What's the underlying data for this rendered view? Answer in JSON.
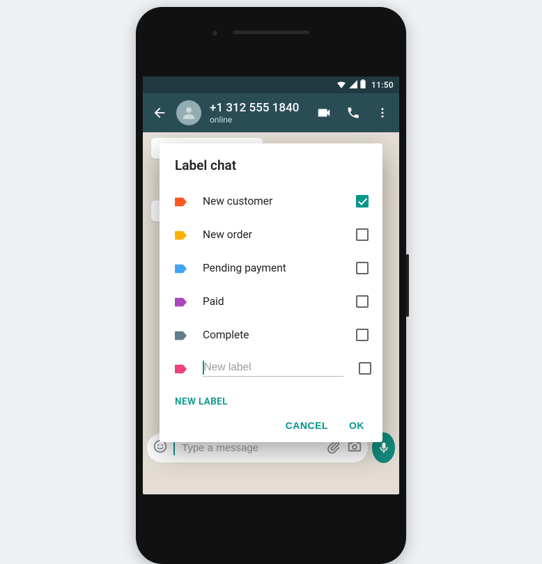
{
  "statusbar": {
    "time": "11:50"
  },
  "header": {
    "contact_name": "+1 312 555 1840",
    "status": "online"
  },
  "composer": {
    "placeholder": "Type a message"
  },
  "dialog": {
    "title": "Label chat",
    "labels": [
      {
        "name": "New customer",
        "color": "#ff5722",
        "checked": true
      },
      {
        "name": "New order",
        "color": "#ffb300",
        "checked": false
      },
      {
        "name": "Pending payment",
        "color": "#42a5f5",
        "checked": false
      },
      {
        "name": "Paid",
        "color": "#ab47bc",
        "checked": false
      },
      {
        "name": "Complete",
        "color": "#607d8b",
        "checked": false
      }
    ],
    "new_label": {
      "color": "#ec407a",
      "placeholder": "New label",
      "value": ""
    },
    "new_label_button": "NEW LABEL",
    "cancel": "CANCEL",
    "ok": "OK"
  }
}
